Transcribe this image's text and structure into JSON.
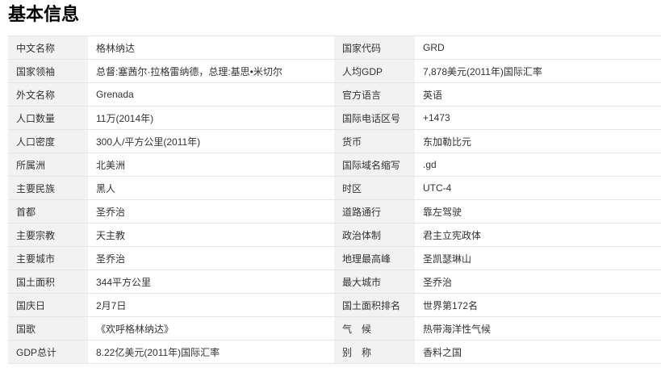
{
  "page": {
    "title": "基本信息"
  },
  "colors": {
    "label_bg": "#f2f2f2",
    "value_bg": "#ffffff",
    "border": "#e6e6e6",
    "text": "#333333",
    "title": "#000000"
  },
  "rows": [
    {
      "left_label": "中文名称",
      "left_value": "格林纳达",
      "right_label": "国家代码",
      "right_value": "GRD"
    },
    {
      "left_label": "国家领袖",
      "left_value": "总督:塞茜尔·拉格雷纳德，总理:基思•米切尔",
      "right_label": "人均GDP",
      "right_value": "7,878美元(2011年)国际汇率"
    },
    {
      "left_label": "外文名称",
      "left_value": "Grenada",
      "right_label": "官方语言",
      "right_value": "英语"
    },
    {
      "left_label": "人口数量",
      "left_value": "11万(2014年)",
      "right_label": "国际电话区号",
      "right_value": "+1473"
    },
    {
      "left_label": "人口密度",
      "left_value": "300人/平方公里(2011年)",
      "right_label": "货币",
      "right_value": "东加勒比元"
    },
    {
      "left_label": "所属洲",
      "left_value": "北美洲",
      "right_label": "国际域名缩写",
      "right_value": ".gd"
    },
    {
      "left_label": "主要民族",
      "left_value": "黑人",
      "right_label": "时区",
      "right_value": "UTC-4"
    },
    {
      "left_label": "首都",
      "left_value": "圣乔治",
      "right_label": "道路通行",
      "right_value": "靠左驾驶"
    },
    {
      "left_label": "主要宗教",
      "left_value": "天主教",
      "right_label": "政治体制",
      "right_value": "君主立宪政体"
    },
    {
      "left_label": "主要城市",
      "left_value": "圣乔治",
      "right_label": "地理最高峰",
      "right_value": "圣凯瑟琳山"
    },
    {
      "left_label": "国土面积",
      "left_value": "344平方公里",
      "right_label": "最大城市",
      "right_value": "圣乔治"
    },
    {
      "left_label": "国庆日",
      "left_value": "2月7日",
      "right_label": "国土面积排名",
      "right_value": "世界第172名"
    },
    {
      "left_label": "国歌",
      "left_value": "《欢呼格林纳达》",
      "right_label": "气　候",
      "right_value": "热带海洋性气候"
    },
    {
      "left_label": "GDP总计",
      "left_value": "8.22亿美元(2011年)国际汇率",
      "right_label": "别　称",
      "right_value": "香料之国"
    }
  ]
}
